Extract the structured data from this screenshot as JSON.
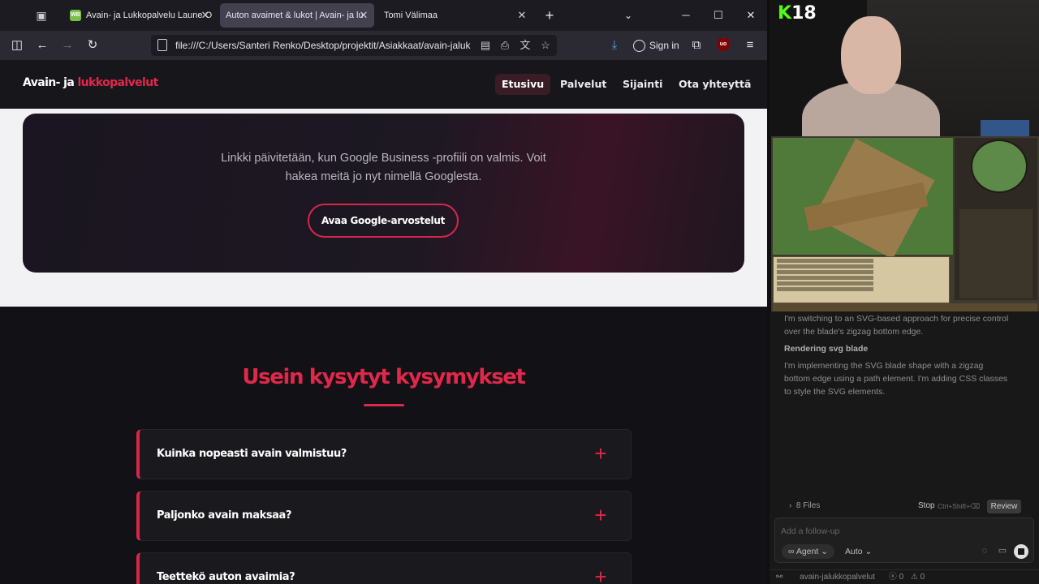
{
  "browser": {
    "tabs": [
      {
        "title": "Avain- ja Lukkopalvelu Laune O",
        "favicon": "WB",
        "active": false
      },
      {
        "title": "Auton avaimet & lukot | Avain- ja lu",
        "active": true
      },
      {
        "title": "Tomi Välimaa",
        "active": false
      }
    ],
    "url": "file:///C:/Users/Santeri Renko/Desktop/projektit/Asiakkaat/avain-jaluk",
    "sign_in": "Sign in",
    "addon_badge": "uo"
  },
  "site": {
    "logo_main": "Avain- ja ",
    "logo_accent": "lukkopalvelut",
    "nav": [
      "Etusivu",
      "Palvelut",
      "Sijainti",
      "Ota yhteyttä"
    ],
    "review": {
      "text_line1": "Linkki päivitetään, kun Google Business -profiili on valmis. Voit",
      "text_line2": "hakea meitä jo nyt nimellä Googlesta.",
      "button": "Avaa Google-arvostelut"
    },
    "faq": {
      "title": "Usein kysytyt kysymykset",
      "items": [
        "Kuinka nopeasti avain valmistuu?",
        "Paljonko avain maksaa?",
        "Teettekö auton avaimia?"
      ]
    }
  },
  "stream": {
    "kick_k": "K",
    "kick_count": "18"
  },
  "agent": {
    "text1_line1": "I'm switching to an SVG-based approach for precise control",
    "text1_line2": "over the blade's zigzag bottom edge.",
    "heading": "Rendering svg blade",
    "text2_line1": "I'm implementing the SVG blade shape with a zigzag",
    "text2_line2": "bottom edge using a path element. I'm adding CSS classes",
    "text2_line3": "to style the SVG elements.",
    "files": "8 Files",
    "stop": "Stop",
    "stop_shortcut": "Ctrl+Shift+⌫",
    "review": "Review",
    "followup_placeholder": "Add a follow-up",
    "mode": "Agent",
    "model": "Auto",
    "project": "avain-jalukkopalvelut",
    "problems": "0",
    "warnings": "0"
  },
  "colors": {
    "accent": "#e0284a",
    "kick": "#53fc18"
  }
}
